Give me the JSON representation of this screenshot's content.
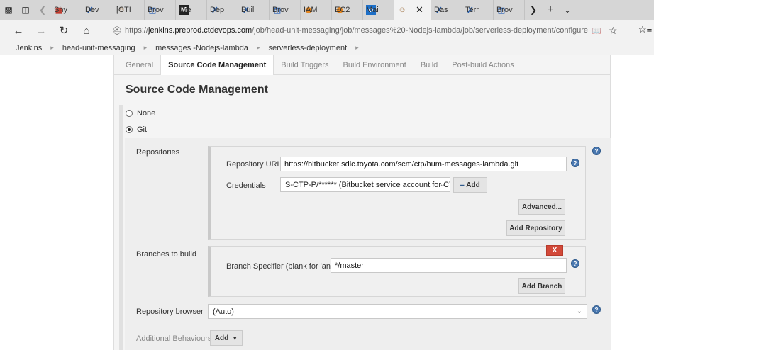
{
  "browser": {
    "tabs": [
      {
        "icon": "window-icon",
        "label": ""
      },
      {
        "icon": "tab-list-icon",
        "label": ""
      },
      {
        "icon": "back-tab-icon",
        "label": ""
      },
      {
        "icon": "slack-icon",
        "label": "Shy"
      },
      {
        "icon": "jira-icon",
        "label": "Dev"
      },
      {
        "icon": "jenkins-icon",
        "label": "[CTI"
      },
      {
        "icon": "db-icon",
        "label": "Brov"
      },
      {
        "icon": "medium-icon",
        "label": "Cre"
      },
      {
        "icon": "jira-icon",
        "label": "Dep"
      },
      {
        "icon": "jira-icon",
        "label": "Buil"
      },
      {
        "icon": "db-icon",
        "label": "Brov"
      },
      {
        "icon": "aws-icon",
        "label": "IAM"
      },
      {
        "icon": "aws-icon",
        "label": "EC2"
      },
      {
        "icon": "outlook-icon",
        "label": "Mai"
      },
      {
        "icon": "jenkins-icon",
        "label": ""
      },
      {
        "icon": "jira-icon",
        "label": "Das"
      },
      {
        "icon": "jira-icon",
        "label": "Terr"
      },
      {
        "icon": "db-icon",
        "label": "Brov"
      }
    ],
    "url_prefix": "https://",
    "url_host": "jenkins.preprod.ctdevops.com",
    "url_path": "/job/head-unit-messaging/job/messages%20-Nodejs-lambda/job/serverless-deployment/configure"
  },
  "breadcrumbs": [
    "Jenkins",
    "head-unit-messaging",
    "messages -Nodejs-lambda",
    "serverless-deployment"
  ],
  "config_tabs": [
    "General",
    "Source Code Management",
    "Build Triggers",
    "Build Environment",
    "Build",
    "Post-build Actions"
  ],
  "scm": {
    "title": "Source Code Management",
    "none_label": "None",
    "git_label": "Git",
    "repositories_label": "Repositories",
    "repo_url_label": "Repository URL",
    "repo_url_value": "https://bitbucket.sdlc.toyota.com/scm/ctp/hum-messages-lambda.git",
    "credentials_label": "Credentials",
    "credentials_value": "S-CTP-P/****** (Bitbucket service account for CT)",
    "add_label": "Add",
    "advanced_label": "Advanced...",
    "add_repository_label": "Add Repository",
    "branches_label": "Branches to build",
    "delete_label": "X",
    "branch_specifier_label": "Branch Specifier (blank for 'any')",
    "branch_specifier_value": "*/master",
    "add_branch_label": "Add Branch",
    "repo_browser_label": "Repository browser",
    "repo_browser_value": "(Auto)",
    "additional_behaviours_label": "Additional Behaviours",
    "add_dropdown_label": "Add"
  }
}
